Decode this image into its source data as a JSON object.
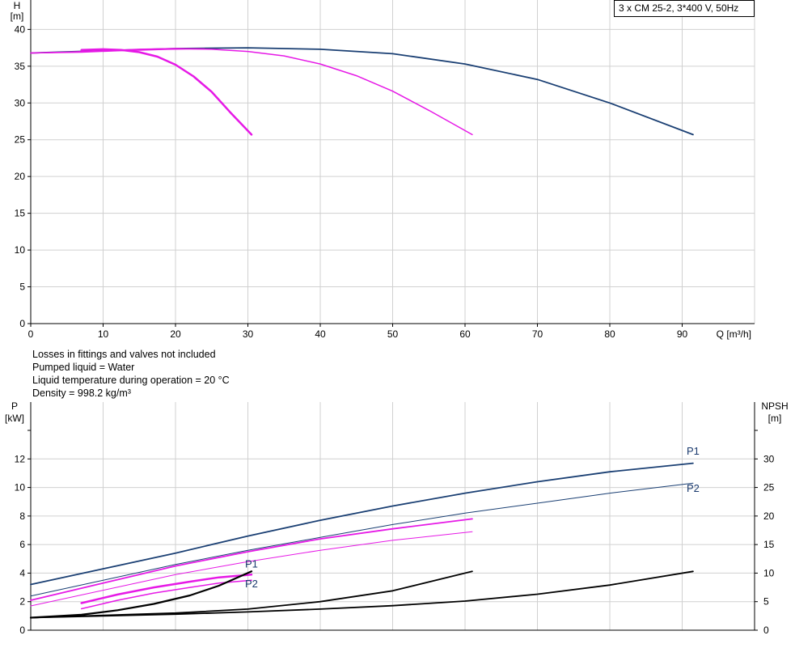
{
  "title": "3 x CM 25-2, 3*400 V, 50Hz",
  "notes": [
    "Losses in fittings and valves not included",
    "Pumped liquid = Water",
    "Liquid temperature during operation = 20 °C",
    "Density = 998.2 kg/m³"
  ],
  "colors": {
    "navy": "#1a3f73",
    "magenta": "#e619e6",
    "black": "#000000",
    "grid": "#d0d0d0"
  },
  "chart_data": [
    {
      "type": "line",
      "xlabel": "Q [m³/h]",
      "ylabel_top": "H",
      "ylabel_unit": "[m]",
      "xlim": [
        0,
        100
      ],
      "ylim": [
        0,
        44
      ],
      "xticks": [
        0,
        10,
        20,
        30,
        40,
        50,
        60,
        70,
        80,
        90
      ],
      "yticks": [
        0,
        5,
        10,
        15,
        20,
        25,
        30,
        35,
        40
      ],
      "grid": true,
      "series": [
        {
          "color": "navy",
          "width": 1.8,
          "x": [
            0,
            10,
            20,
            30,
            40,
            50,
            60,
            70,
            80,
            91.5
          ],
          "y": [
            36.8,
            37.1,
            37.4,
            37.5,
            37.3,
            36.7,
            35.3,
            33.2,
            30.0,
            25.7
          ]
        },
        {
          "color": "magenta",
          "width": 1.5,
          "x": [
            0,
            5,
            10,
            15,
            20,
            25,
            30,
            35,
            40,
            45,
            50,
            55,
            61
          ],
          "y": [
            36.8,
            36.9,
            37.1,
            37.3,
            37.4,
            37.3,
            37.0,
            36.4,
            35.3,
            33.7,
            31.6,
            29.0,
            25.7
          ]
        },
        {
          "color": "magenta",
          "width": 2.5,
          "x": [
            7,
            10,
            12.5,
            15,
            17.5,
            20,
            22.5,
            25,
            27.5,
            30.5
          ],
          "y": [
            37.2,
            37.3,
            37.2,
            36.9,
            36.3,
            35.2,
            33.6,
            31.5,
            28.8,
            25.7
          ]
        },
        {
          "color": "magenta",
          "width": 1.5,
          "x": [
            0,
            7,
            12,
            16,
            19,
            22,
            24
          ],
          "y": [
            36.8,
            36.9,
            37.1,
            37.2,
            37.3,
            37.35,
            37.35
          ]
        }
      ]
    },
    {
      "type": "line",
      "xlim": [
        0,
        100
      ],
      "ylabel_left": "P",
      "ylabel_left_unit": "[kW]",
      "ylabel_right": "NPSH",
      "ylabel_right_unit": "[m]",
      "ylim_left": [
        0,
        14
      ],
      "ylim_right": [
        0,
        35
      ],
      "yticks_left": [
        0,
        2,
        4,
        6,
        8,
        10,
        12
      ],
      "yticks_right": [
        0,
        5,
        10,
        15,
        20,
        25,
        30
      ],
      "grid": true,
      "labels": [
        {
          "text": "P1",
          "x": 91.5,
          "y": 12.3
        },
        {
          "text": "P2",
          "x": 91.5,
          "y": 9.7
        },
        {
          "text": "P1",
          "x": 30.5,
          "y": 4.4
        },
        {
          "text": "P2",
          "x": 30.5,
          "y": 3.0
        }
      ],
      "series": [
        {
          "color": "navy",
          "width": 1.8,
          "axis": "left",
          "x": [
            0,
            10,
            20,
            30,
            40,
            50,
            60,
            70,
            80,
            91.5
          ],
          "y": [
            3.2,
            4.3,
            5.4,
            6.6,
            7.7,
            8.7,
            9.6,
            10.4,
            11.1,
            11.7
          ]
        },
        {
          "color": "navy",
          "width": 1.0,
          "axis": "left",
          "x": [
            0,
            10,
            20,
            30,
            40,
            50,
            60,
            70,
            80,
            91.5
          ],
          "y": [
            2.4,
            3.5,
            4.6,
            5.6,
            6.5,
            7.4,
            8.2,
            8.9,
            9.6,
            10.3
          ]
        },
        {
          "color": "magenta",
          "width": 1.8,
          "axis": "left",
          "x": [
            0,
            10,
            20,
            30,
            40,
            50,
            61
          ],
          "y": [
            2.1,
            3.3,
            4.5,
            5.5,
            6.4,
            7.1,
            7.8
          ]
        },
        {
          "color": "magenta",
          "width": 1.0,
          "axis": "left",
          "x": [
            0,
            10,
            20,
            30,
            40,
            50,
            61
          ],
          "y": [
            1.7,
            2.8,
            3.9,
            4.8,
            5.6,
            6.3,
            6.9
          ]
        },
        {
          "color": "magenta",
          "width": 2.5,
          "axis": "left",
          "x": [
            7,
            12,
            17,
            22,
            26,
            30.5
          ],
          "y": [
            1.9,
            2.5,
            3.0,
            3.4,
            3.7,
            3.9
          ]
        },
        {
          "color": "magenta",
          "width": 1.5,
          "axis": "left",
          "x": [
            7,
            12,
            17,
            22,
            26,
            30.5
          ],
          "y": [
            1.5,
            2.1,
            2.6,
            3.0,
            3.3,
            3.5
          ]
        },
        {
          "color": "black",
          "width": 2.2,
          "axis": "right",
          "x": [
            0,
            7,
            12,
            17,
            22,
            26,
            30.5
          ],
          "y": [
            2.2,
            2.7,
            3.5,
            4.6,
            6.1,
            7.8,
            10.3
          ]
        },
        {
          "color": "black",
          "width": 1.8,
          "axis": "right",
          "x": [
            0,
            10,
            20,
            30,
            40,
            50,
            61
          ],
          "y": [
            2.2,
            2.6,
            3.0,
            3.7,
            5.0,
            6.9,
            10.3
          ]
        },
        {
          "color": "black",
          "width": 1.8,
          "axis": "right",
          "x": [
            0,
            10,
            20,
            30,
            40,
            50,
            60,
            70,
            80,
            91.5
          ],
          "y": [
            2.2,
            2.5,
            2.8,
            3.2,
            3.7,
            4.3,
            5.1,
            6.3,
            7.9,
            10.3
          ]
        }
      ]
    }
  ]
}
